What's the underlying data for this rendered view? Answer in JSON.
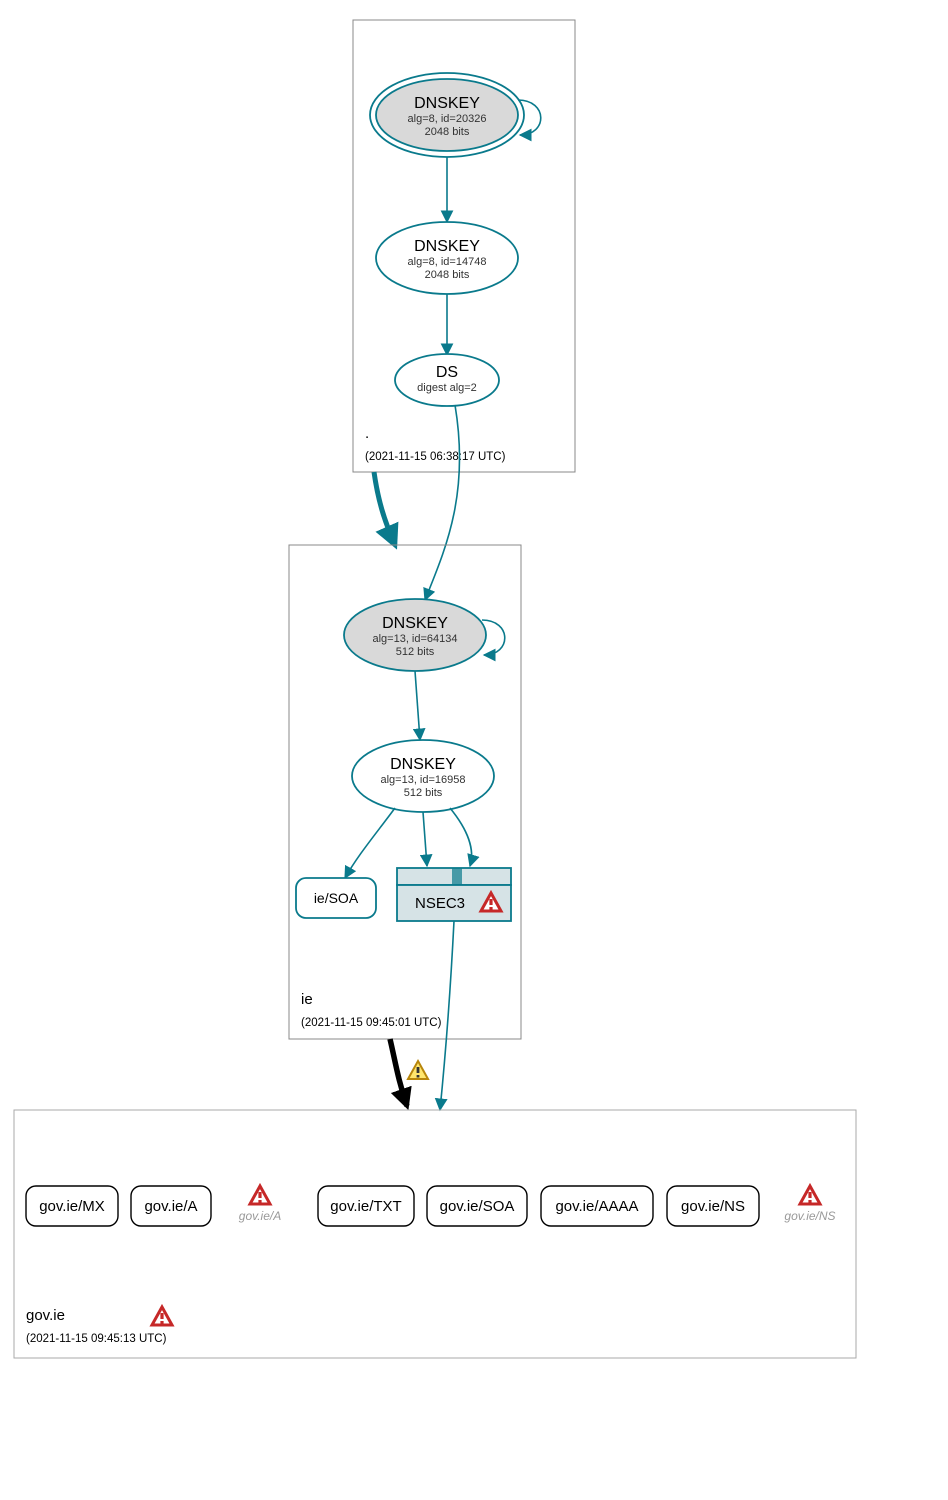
{
  "zones": {
    "root": {
      "label": ".",
      "timestamp": "(2021-11-15 06:38:17 UTC)"
    },
    "ie": {
      "label": "ie",
      "timestamp": "(2021-11-15 09:45:01 UTC)"
    },
    "gov": {
      "label": "gov.ie",
      "timestamp": "(2021-11-15 09:45:13 UTC)"
    }
  },
  "nodes": {
    "root_ksk": {
      "title": "DNSKEY",
      "line1": "alg=8, id=20326",
      "line2": "2048 bits"
    },
    "root_zsk": {
      "title": "DNSKEY",
      "line1": "alg=8, id=14748",
      "line2": "2048 bits"
    },
    "root_ds": {
      "title": "DS",
      "line1": "digest alg=2"
    },
    "ie_ksk": {
      "title": "DNSKEY",
      "line1": "alg=13, id=64134",
      "line2": "512 bits"
    },
    "ie_zsk": {
      "title": "DNSKEY",
      "line1": "alg=13, id=16958",
      "line2": "512 bits"
    },
    "ie_soa": {
      "label": "ie/SOA"
    },
    "ie_nsec3": {
      "label": "NSEC3"
    },
    "gov_mx": {
      "label": "gov.ie/MX"
    },
    "gov_a": {
      "label": "gov.ie/A"
    },
    "gov_a_gray": {
      "label": "gov.ie/A"
    },
    "gov_txt": {
      "label": "gov.ie/TXT"
    },
    "gov_soa": {
      "label": "gov.ie/SOA"
    },
    "gov_aaaa": {
      "label": "gov.ie/AAAA"
    },
    "gov_ns": {
      "label": "gov.ie/NS"
    },
    "gov_ns_gray": {
      "label": "gov.ie/NS"
    }
  },
  "icons": {
    "warn_yellow": "warning",
    "warn_red": "error"
  }
}
